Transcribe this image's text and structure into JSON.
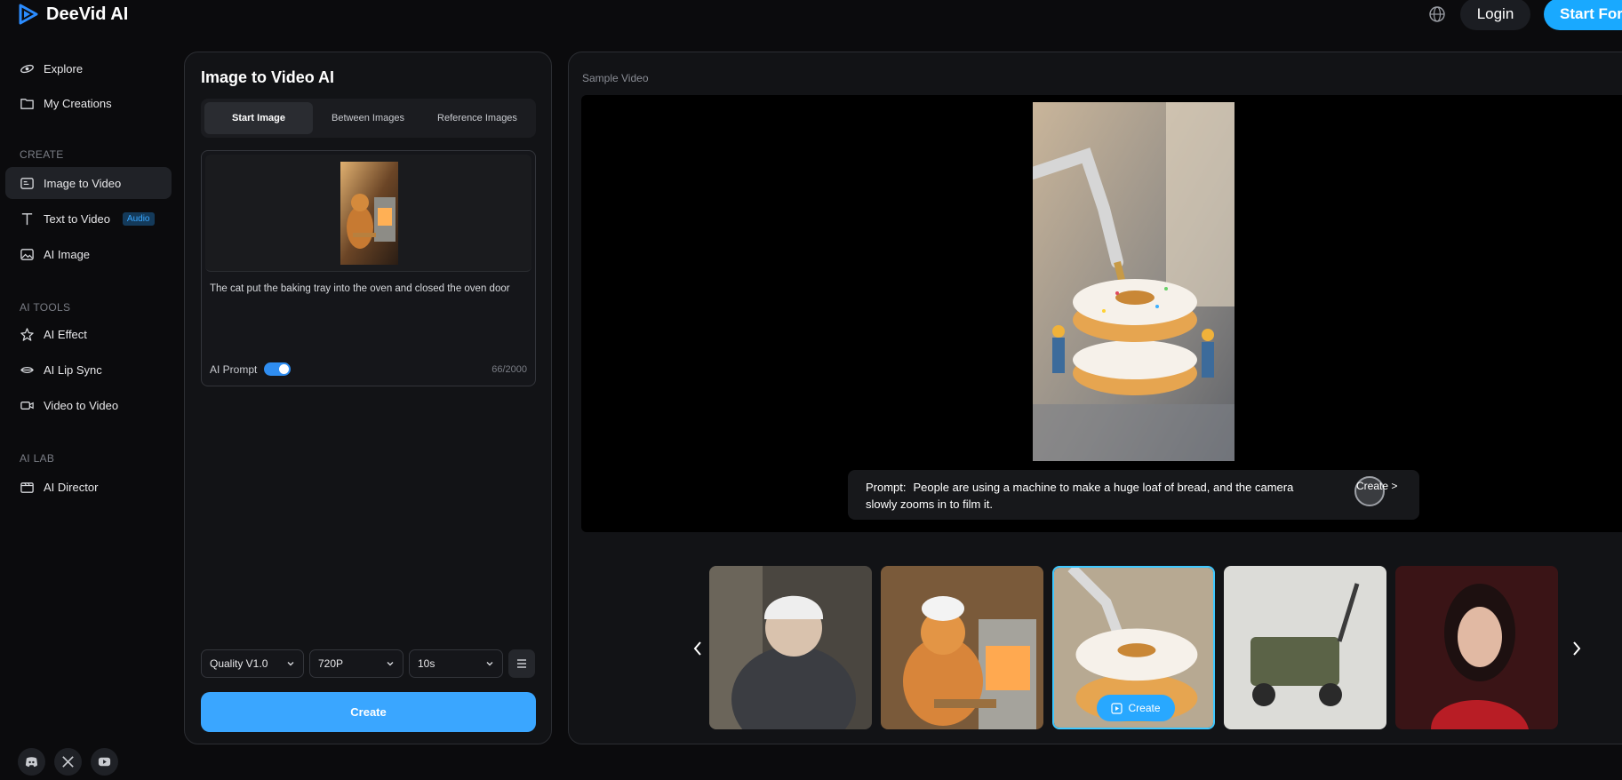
{
  "app": {
    "name": "DeeVid AI"
  },
  "header": {
    "login_label": "Login",
    "start_label": "Start For"
  },
  "sidebar": {
    "explore": "Explore",
    "my_creations": "My Creations",
    "create_section": "CREATE",
    "image_to_video": "Image to Video",
    "text_to_video": "Text to Video",
    "audio_badge": "Audio",
    "ai_image": "AI Image",
    "ai_tools_section": "AI TOOLS",
    "ai_effect": "AI Effect",
    "ai_lip_sync": "AI Lip Sync",
    "video_to_video": "Video to Video",
    "ai_lab_section": "AI LAB",
    "ai_director": "AI Director"
  },
  "editor": {
    "title": "Image to Video AI",
    "tabs": [
      "Start Image",
      "Between Images",
      "Reference Images"
    ],
    "prompt": "The cat put the baking tray into the oven and closed the oven door",
    "ai_prompt_label": "AI Prompt",
    "ai_prompt_enabled": true,
    "char_count": "66/2000",
    "quality": "Quality V1.0",
    "resolution": "720P",
    "duration": "10s",
    "create_label": "Create"
  },
  "preview": {
    "label": "Sample Video",
    "prompt_label": "Prompt:",
    "prompt_text": "People are using a machine to make a huge loaf of bread, and the camera slowly zooms in to film it.",
    "create_label": "Create >",
    "thumbnail_create_label": "Create",
    "selected_thumbnail": 3
  },
  "colors": {
    "accent": "#3aa6ff",
    "brand": "#19a9ff",
    "selected_border": "#3ec8ff"
  }
}
